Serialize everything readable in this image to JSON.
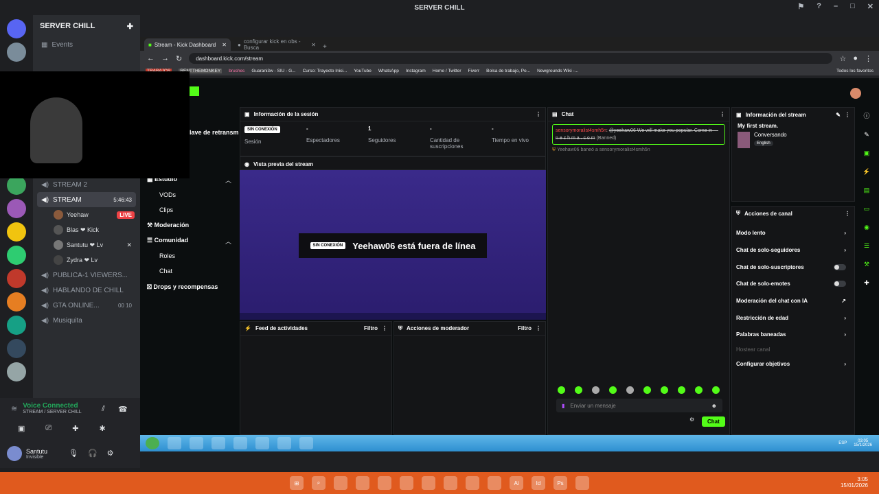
{
  "discord": {
    "window_title": "SERVER CHILL",
    "server_name": "SERVER CHILL",
    "events_label": "Events",
    "channels": [
      {
        "name": "STREAM 2"
      },
      {
        "name": "STREAM",
        "timer": "5:46:43"
      },
      {
        "name": "PUBLICA-1 VIEWERS..."
      },
      {
        "name": "HABLANDO DE CHILL"
      },
      {
        "name": "GTA ONLINE...",
        "counts": "00 10"
      },
      {
        "name": "Musiquita"
      }
    ],
    "voice_users": [
      {
        "name": "Yeehaw",
        "badge": "LIVE"
      },
      {
        "name": "Blas ❤ Kick"
      },
      {
        "name": "Santutu ❤ Lv"
      },
      {
        "name": "Zydra ❤ Lv"
      }
    ],
    "voice_connected": "Voice Connected",
    "voice_channel": "STREAM / SERVER CHILL",
    "user_name": "Santutu",
    "user_status": "Invisible"
  },
  "browser": {
    "tabs": [
      {
        "label": "Stream - Kick Dashboard"
      },
      {
        "label": "configurar kick en obs - Busca"
      }
    ],
    "url": "dashboard.kick.com/stream",
    "bookmarks": [
      "TRABAJOS",
      "RENTTHEMONKEY",
      "brushes",
      "Guarani3w - SIU - G...",
      "Curso: Trayecto Inici...",
      "YouTube",
      "WhatsApp",
      "Instagram",
      "Home / Twitter",
      "Fiverr",
      "Bolsa de trabajo, Po...",
      "Newgrounds Wiki -...",
      "Todos los favoritos"
    ]
  },
  "kick": {
    "sidebar_partial": "lave de retransm",
    "nav": {
      "studio": "Estudio",
      "vods": "VODs",
      "clips": "Clips",
      "moderation": "Moderación",
      "community": "Comunidad",
      "roles": "Roles",
      "chat": "Chat",
      "drops": "Drops y recompensas"
    },
    "session": {
      "title": "Información de la sesión",
      "status_badge": "SIN CONEXIÓN",
      "status_label": "Sesión",
      "viewers_value": "-",
      "viewers_label": "Espectadores",
      "followers_value": "1",
      "followers_label": "Seguidores",
      "subs_value": "-",
      "subs_label": "Cantidad de suscripciones",
      "live_value": "-",
      "live_label": "Tiempo en vivo"
    },
    "preview": {
      "title": "Vista previa del stream",
      "badge": "SIN CONEXIÓN",
      "message": "Yeehaw06 está fuera de línea"
    },
    "feed": {
      "title": "Feed de actividades",
      "filter": "Filtro"
    },
    "modactions": {
      "title": "Acciones de moderador",
      "filter": "Filtro"
    },
    "chat": {
      "title": "Chat",
      "spam_user": "sensorymoralist4smh5n",
      "spam_text": "@yeehaw06 We will make you popular. Come in — n e z h m a . c o m",
      "spam_tag": "(Banned)",
      "ban_notice_user": "Yeehaw06",
      "ban_notice_verb": "baneó a",
      "ban_notice_target": "sensorymoralist4smh5n",
      "placeholder": "Enviar un mensaje",
      "send_label": "Chat"
    },
    "stream_info": {
      "title": "Información del stream",
      "stream_title": "My first stream.",
      "category": "Conversando",
      "language": "English"
    },
    "channel_actions": {
      "title": "Acciones de canal",
      "items": [
        {
          "label": "Modo lento",
          "control": "arrow"
        },
        {
          "label": "Chat de solo-seguidores",
          "control": "arrow"
        },
        {
          "label": "Chat de solo-suscriptores",
          "control": "toggle"
        },
        {
          "label": "Chat de solo-emotes",
          "control": "toggle"
        },
        {
          "label": "Moderación del chat con IA",
          "control": "link"
        },
        {
          "label": "Restricción de edad",
          "control": "arrow"
        },
        {
          "label": "Palabras baneadas",
          "control": "arrow"
        },
        {
          "label": "Hostear canal",
          "control": "none"
        },
        {
          "label": "Configurar objetivos",
          "control": "arrow"
        }
      ]
    }
  },
  "taskbar_old": {
    "lang": "ESP",
    "time": "03:05",
    "date": "15/1/2026"
  },
  "taskbar_new": {
    "time": "3:05",
    "date": "15/01/2026"
  }
}
